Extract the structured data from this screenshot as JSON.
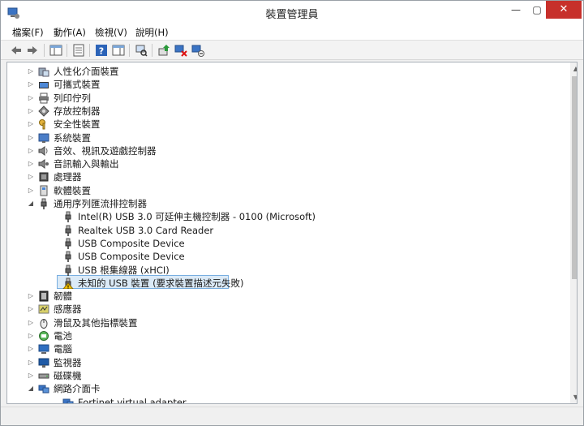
{
  "window": {
    "title": "裝置管理員",
    "close_glyph": "✕",
    "max_glyph": "▢",
    "min_glyph": "—"
  },
  "menu": [
    "檔案(F)",
    "動作(A)",
    "檢視(V)",
    "說明(H)"
  ],
  "toolbar": [
    "back-arrow-icon",
    "forward-arrow-icon",
    "show-hide-console-tree-icon",
    "properties-icon",
    "help-icon",
    "show-action-pane-icon",
    "scan-hardware-icon",
    "update-driver-icon",
    "disable-device-icon",
    "uninstall-device-icon"
  ],
  "tree": [
    {
      "label": "人性化介面裝置",
      "level": 1,
      "expander": "collapsed",
      "icon": "hid-icon"
    },
    {
      "label": "可攜式裝置",
      "level": 1,
      "expander": "collapsed",
      "icon": "portable-device-icon"
    },
    {
      "label": "列印佇列",
      "level": 1,
      "expander": "collapsed",
      "icon": "printer-icon"
    },
    {
      "label": "存放控制器",
      "level": 1,
      "expander": "collapsed",
      "icon": "storage-controller-icon"
    },
    {
      "label": "安全性裝置",
      "level": 1,
      "expander": "collapsed",
      "icon": "security-key-icon"
    },
    {
      "label": "系統裝置",
      "level": 1,
      "expander": "collapsed",
      "icon": "system-device-icon"
    },
    {
      "label": "音效、視訊及遊戲控制器",
      "level": 1,
      "expander": "collapsed",
      "icon": "speaker-icon"
    },
    {
      "label": "音訊輸入與輸出",
      "level": 1,
      "expander": "collapsed",
      "icon": "audio-io-icon"
    },
    {
      "label": "處理器",
      "level": 1,
      "expander": "collapsed",
      "icon": "processor-icon"
    },
    {
      "label": "軟體裝置",
      "level": 1,
      "expander": "collapsed",
      "icon": "software-device-icon"
    },
    {
      "label": "通用序列匯流排控制器",
      "level": 1,
      "expander": "expanded",
      "icon": "usb-plug-icon"
    },
    {
      "label": "Intel(R) USB 3.0 可延伸主機控制器 - 0100 (Microsoft)",
      "level": 2,
      "expander": "none",
      "icon": "usb-plug-icon"
    },
    {
      "label": "Realtek USB 3.0 Card Reader",
      "level": 2,
      "expander": "none",
      "icon": "usb-plug-icon"
    },
    {
      "label": "USB Composite Device",
      "level": 2,
      "expander": "none",
      "icon": "usb-plug-icon"
    },
    {
      "label": "USB Composite Device",
      "level": 2,
      "expander": "none",
      "icon": "usb-plug-icon"
    },
    {
      "label": "USB 根集線器 (xHCI)",
      "level": 2,
      "expander": "none",
      "icon": "usb-plug-icon"
    },
    {
      "label": "未知的 USB 裝置 (要求裝置描述元失敗)",
      "level": 2,
      "expander": "none",
      "icon": "warning-usb-icon",
      "selected": true
    },
    {
      "label": "韌體",
      "level": 1,
      "expander": "collapsed",
      "icon": "firmware-icon"
    },
    {
      "label": "感應器",
      "level": 1,
      "expander": "collapsed",
      "icon": "sensor-icon"
    },
    {
      "label": "滑鼠及其他指標裝置",
      "level": 1,
      "expander": "collapsed",
      "icon": "mouse-icon"
    },
    {
      "label": "電池",
      "level": 1,
      "expander": "collapsed",
      "icon": "battery-icon"
    },
    {
      "label": "電腦",
      "level": 1,
      "expander": "collapsed",
      "icon": "computer-icon"
    },
    {
      "label": "監視器",
      "level": 1,
      "expander": "collapsed",
      "icon": "monitor-icon"
    },
    {
      "label": "磁碟機",
      "level": 1,
      "expander": "collapsed",
      "icon": "disk-drive-icon"
    },
    {
      "label": "網路介面卡",
      "level": 1,
      "expander": "expanded",
      "icon": "network-adapter-icon"
    },
    {
      "label": "Fortinet virtual adapter",
      "level": 2,
      "expander": "none",
      "icon": "network-adapter-icon"
    }
  ],
  "colors": {
    "close": "#c7302b",
    "selection": "#dbeaf7",
    "selection_border": "#78aee0"
  }
}
